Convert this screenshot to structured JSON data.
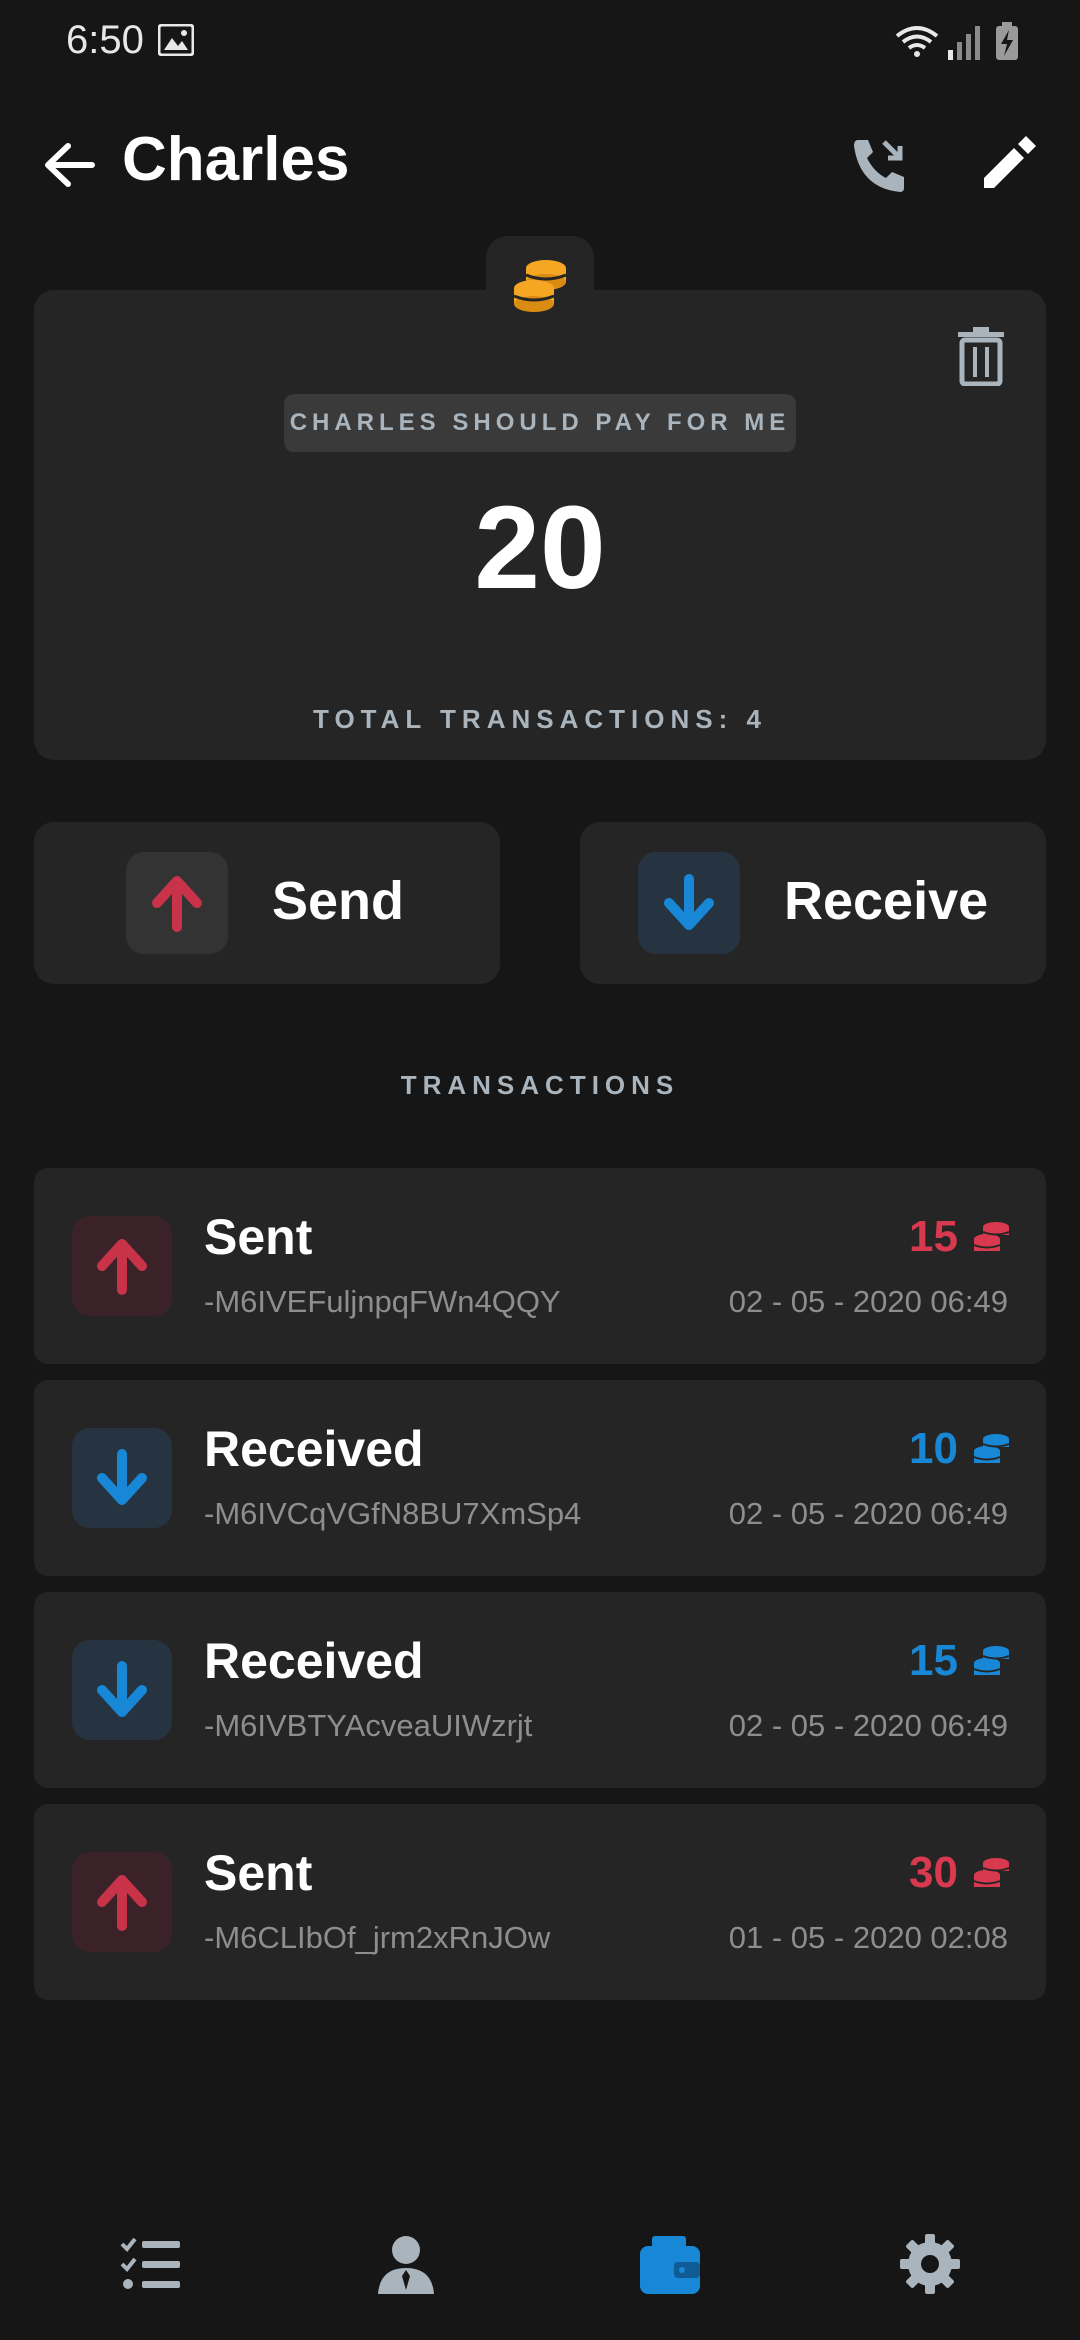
{
  "status_bar": {
    "time": "6:50"
  },
  "header": {
    "title": "Charles"
  },
  "balance_card": {
    "status_label": "CHARLES SHOULD PAY FOR ME",
    "amount": "20",
    "total_transactions": "TOTAL TRANSACTIONS: 4"
  },
  "actions": {
    "send_label": "Send",
    "receive_label": "Receive"
  },
  "transactions_title": "TRANSACTIONS",
  "transactions": [
    {
      "type": "Sent",
      "id": "-M6IVEFuljnpqFWn4QQY",
      "amount": "15",
      "date": "02 - 05 - 2020 06:49"
    },
    {
      "type": "Received",
      "id": "-M6IVCqVGfN8BU7XmSp4",
      "amount": "10",
      "date": "02 - 05 - 2020 06:49"
    },
    {
      "type": "Received",
      "id": "-M6IVBTYAcveaUIWzrjt",
      "amount": "15",
      "date": "02 - 05 - 2020 06:49"
    },
    {
      "type": "Sent",
      "id": "-M6CLIbOf_jrm2xRnJOw",
      "amount": "30",
      "date": "01 - 05 - 2020 02:08"
    }
  ],
  "icons": {
    "status_bar": [
      "image-icon",
      "wifi-icon",
      "signal-icon",
      "battery-charging-icon"
    ],
    "header": [
      "back-arrow-icon",
      "call-icon",
      "edit-pencil-icon"
    ],
    "card": [
      "coins-icon",
      "trash-icon"
    ],
    "nav": [
      "tasks-list-icon",
      "person-icon",
      "wallet-icon",
      "settings-gear-icon"
    ]
  },
  "colors": {
    "background": "#161616",
    "card": "#252525",
    "sent": "#d9394f",
    "received": "#1887d6",
    "coin": "#f5a623",
    "muted": "#a9b4bd",
    "nav_active": "#1887d6"
  }
}
